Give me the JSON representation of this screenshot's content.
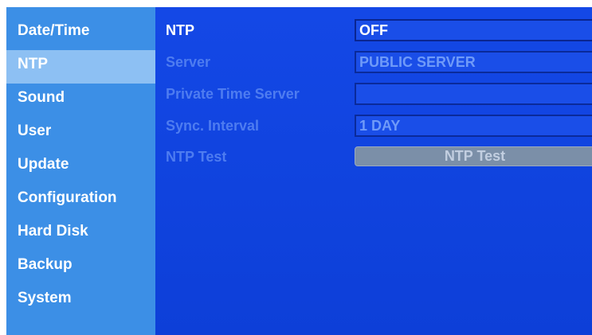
{
  "sidebar": {
    "items": [
      {
        "label": "Date/Time"
      },
      {
        "label": "NTP"
      },
      {
        "label": "Sound"
      },
      {
        "label": "User"
      },
      {
        "label": "Update"
      },
      {
        "label": "Configuration"
      },
      {
        "label": "Hard Disk"
      },
      {
        "label": "Backup"
      },
      {
        "label": "System"
      }
    ],
    "selected": "NTP"
  },
  "settings": {
    "ntp": {
      "label": "NTP",
      "value": "OFF"
    },
    "server": {
      "label": "Server",
      "value": "PUBLIC SERVER"
    },
    "private_server": {
      "label": "Private Time Server",
      "value": ""
    },
    "sync_interval": {
      "label": "Sync. Interval",
      "value": "1 DAY"
    },
    "ntp_test": {
      "label": "NTP Test",
      "button_label": "NTP Test"
    }
  },
  "colors": {
    "sidebar_bg": "#3c8fe6",
    "sidebar_selected": "#8dc0f3",
    "main_bg": "#1448e6",
    "disabled_text": "#4e7cf0",
    "button_bg": "#7b8fa8"
  }
}
